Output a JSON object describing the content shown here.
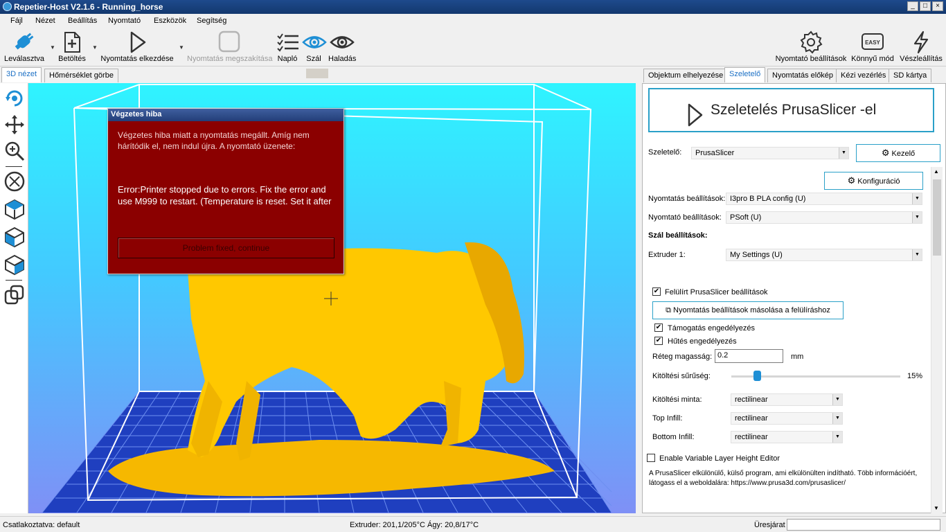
{
  "window": {
    "title": "Repetier-Host V2.1.6 - Running_horse",
    "minimize": "_",
    "maximize": "□",
    "close": "×"
  },
  "menu": [
    "Fájl",
    "Nézet",
    "Beállítás",
    "Nyomtató",
    "Eszközök",
    "Segítség"
  ],
  "toolbar": {
    "disconnect": "Leválasztva",
    "load": "Betöltés",
    "start_print": "Nyomtatás elkezdése",
    "stop_print": "Nyomtatás megszakítása",
    "log": "Napló",
    "filament": "Szál",
    "progress": "Haladás",
    "printer_settings": "Nyomtató beállítások",
    "easy_mode": "Könnyű mód",
    "easy_badge": "EASY",
    "emergency": "Vészleállítás"
  },
  "left_tabs": [
    "3D nézet",
    "Hőmérséklet görbe"
  ],
  "dialog": {
    "title": "Végzetes hiba",
    "message": "Végzetes hiba miatt a nyomtatás megállt. Amíg nem hárítódik el, nem indul újra. A nyomtató üzenete:",
    "error": "Error:Printer stopped due to errors. Fix the error and use M999 to restart. (Temperature is reset. Set it after",
    "button": "Problem fixed, continue"
  },
  "right_tabs": [
    "Objektum elhelyezése",
    "Szeletelő",
    "Nyomtatás előkép",
    "Kézi vezérlés",
    "SD kártya"
  ],
  "slicer": {
    "slice_button": "Szeletelés PrusaSlicer -el",
    "slicer_label": "Szeletelő:",
    "slicer_value": "PrusaSlicer",
    "manager_button": "Kezelő",
    "config_button": "Konfiguráció",
    "print_settings_label": "Nyomtatás beállítások:",
    "print_settings_value": "I3pro B PLA config (U)",
    "printer_settings_label": "Nyomtató beállítások:",
    "printer_settings_value": "PSoft (U)",
    "filament_settings_heading": "Szál beállítások:",
    "extruder1_label": "Extruder 1:",
    "extruder1_value": "My Settings (U)",
    "override_label": "Felülírt PrusaSlicer beállítások",
    "copy_button": "Nyomtatás beállítások másolása a felülíráshoz",
    "support_label": "Támogatás engedélyezés",
    "cooling_label": "Hűtés engedélyezés",
    "layer_height_label": "Réteg magasság:",
    "layer_height_value": "0.2",
    "layer_height_unit": "mm",
    "infill_density_label": "Kitöltési sűrűség:",
    "infill_density_value": "15%",
    "infill_density_fraction": 0.15,
    "infill_pattern_label": "Kitöltési minta:",
    "infill_pattern_value": "rectilinear",
    "top_infill_label": "Top Infill:",
    "top_infill_value": "rectilinear",
    "bottom_infill_label": "Bottom Infill:",
    "bottom_infill_value": "rectilinear",
    "variable_layer_label": "Enable Variable Layer Height Editor",
    "info_text": "A PrusaSlicer elkülönülő, külső program, ami elkülönülten indítható. Több információért, látogass el a weboldalára: https://www.prusa3d.com/prusaslicer/"
  },
  "status": {
    "connection": "Csatlakoztatva: default",
    "temps": "Extruder: 201,1/205°C Ágy: 20,8/17°C",
    "idle": "Üresjárat"
  },
  "colors": {
    "accent": "#2aa0c8",
    "dialog_bg": "#8b0000",
    "model": "#ffc800"
  }
}
